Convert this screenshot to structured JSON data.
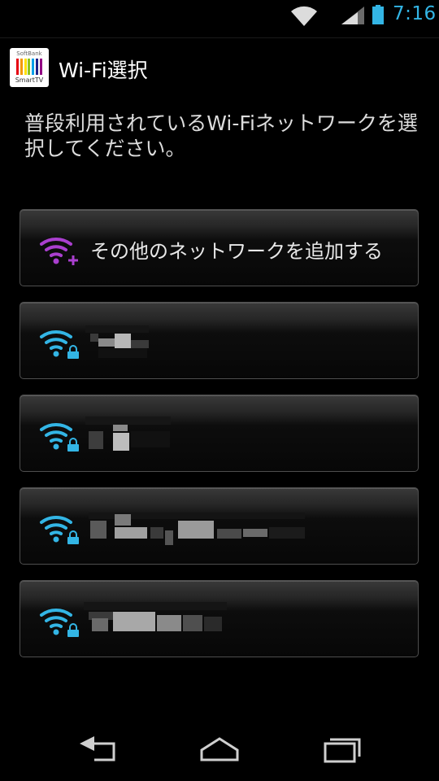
{
  "status_bar": {
    "time": "7:16"
  },
  "app": {
    "title": "Wi-Fi選択",
    "icon_brand": "SoftBank",
    "icon_label": "SmartTV"
  },
  "description": "普段利用されているWi-Fiネットワークを選択してください。",
  "networks": [
    {
      "label": "その他のネットワークを追加する",
      "icon": "wifi-add-icon"
    },
    {
      "label": "",
      "icon": "wifi-lock-icon"
    },
    {
      "label": "",
      "icon": "wifi-lock-icon"
    },
    {
      "label": "",
      "icon": "wifi-lock-icon"
    },
    {
      "label": "",
      "icon": "wifi-lock-icon"
    }
  ],
  "colors": {
    "accent": "#33b5e5",
    "add_icon": "#aa3fcf",
    "wifi_icon": "#33b5e5"
  }
}
